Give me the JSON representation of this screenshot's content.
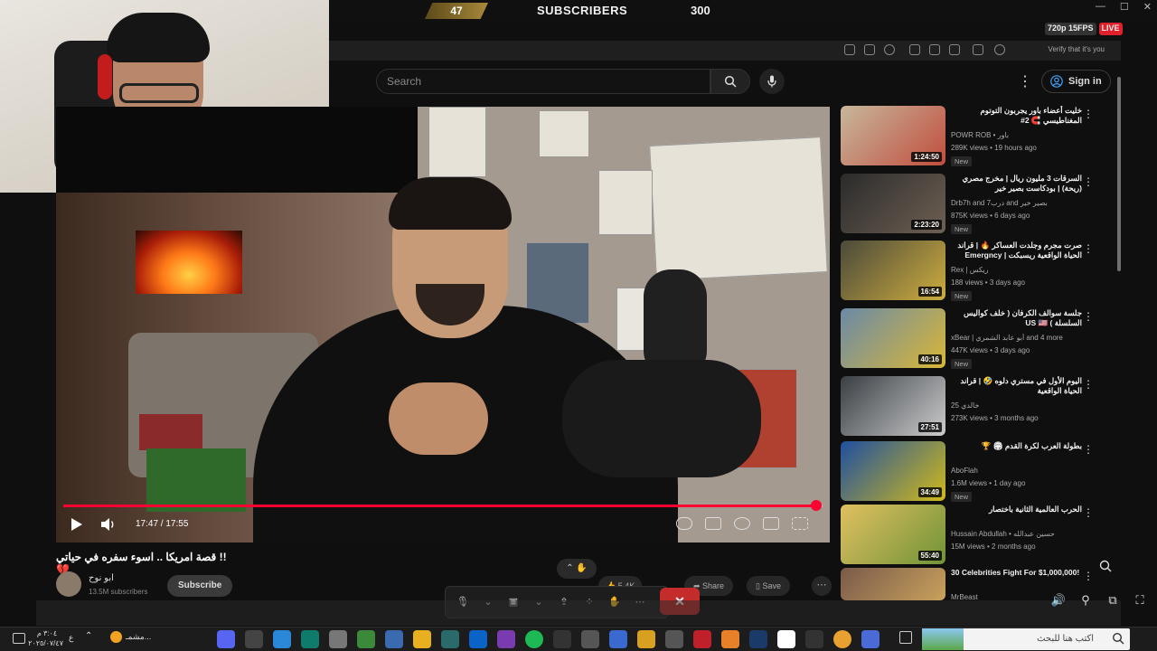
{
  "overlay": {
    "left_count": "47",
    "subs_title": "SUBSCRIBERS",
    "subs_count": "300",
    "stream_res": "720p 15FPS",
    "stream_live": "LIVE"
  },
  "browser": {
    "promo": "Verify that it's you"
  },
  "header": {
    "search_placeholder": "Search",
    "signin_label": "Sign in"
  },
  "player": {
    "time": "17:47 / 17:55",
    "progress": 0.992
  },
  "video": {
    "title": "!! قصة امريكا .. اسوء سفره في حياتي 💔",
    "channel": "ابو نوح",
    "subscribers": "13.5M subscribers",
    "subscribe_label": "Subscribe",
    "likes": "5.4K",
    "share_label": "Share",
    "save_label": "Save"
  },
  "recommendations": [
    {
      "title": "خليت أعضاء باور يجربون التوتوم المغناطيسي 🧲 2#",
      "channel": "POWR ROB • باور",
      "meta": "289K views • 19 hours ago",
      "badge": "New",
      "duration": "1:24:50",
      "color": "#c7b79c",
      "accent": "#c0392b"
    },
    {
      "title": "السرقات 3 مليون ريال | مخرج مصري (ريحة) | بودكاست بصير خير",
      "channel": "Drb7h and درب7 and بصير خير",
      "meta": "875K views • 6 days ago",
      "badge": "New",
      "duration": "2:23:20",
      "color": "#2b2b2b",
      "accent": "#7b6a5a"
    },
    {
      "title": "صرت مجرم وجلدت العساكر 🔥 | قراند الحياة الواقعية ريسبكت | Emergncy",
      "channel": "Rex | ريكس",
      "meta": "188 views • 3 days ago",
      "badge": "New",
      "duration": "16:54",
      "color": "#4a4a3a",
      "accent": "#e8c040"
    },
    {
      "title": "جلسة سوالف الكرفان ( خلف كواليس السلسلة ) US 🇺🇸",
      "channel": "xBear | أبو عابد الشمري and 4 more",
      "meta": "447K views • 3 days ago",
      "badge": "New",
      "duration": "40:16",
      "color": "#6a8aa8",
      "accent": "#f0c020"
    },
    {
      "title": "اليوم الأول في مستري دلوه 🤣 | قراند الحياة الواقعية",
      "channel": "خالدي 25",
      "meta": "273K views • 3 months ago",
      "badge": "",
      "duration": "27:51",
      "color": "#3a3f44",
      "accent": "#e8e8e8"
    },
    {
      "title": "بطولة العرب لكرة القدم 🏟 🏆",
      "channel": "AboFlah",
      "meta": "1.6M views • 1 day ago",
      "badge": "New",
      "duration": "34:49",
      "color": "#1f4fa0",
      "accent": "#f4d000"
    },
    {
      "title": "الحرب العالمية الثانية باختصار",
      "channel": "Hussain Abdullah • حسين عبدالله",
      "meta": "15M views • 2 months ago",
      "badge": "",
      "duration": "55:40",
      "color": "#e0c060",
      "accent": "#5a8a30"
    },
    {
      "title": "30 Celebrities Fight For $1,000,000!",
      "channel": "MrBeast",
      "meta": "",
      "badge": "",
      "duration": "",
      "color": "#7a5a4a",
      "accent": "#d8b060"
    }
  ],
  "meeting": {
    "leave_icon": "x-icon"
  },
  "taskbar": {
    "search_placeholder": "اكتب هنا للبحث",
    "weather": "مشمـ...",
    "time": "٣:٠٤ م",
    "date": "٢٠٢٥/٠٧/٤٧",
    "lang": "ع"
  },
  "colors": {
    "accent": "#ff0033",
    "background": "#0f0f0f",
    "leave": "#c42b2b"
  }
}
